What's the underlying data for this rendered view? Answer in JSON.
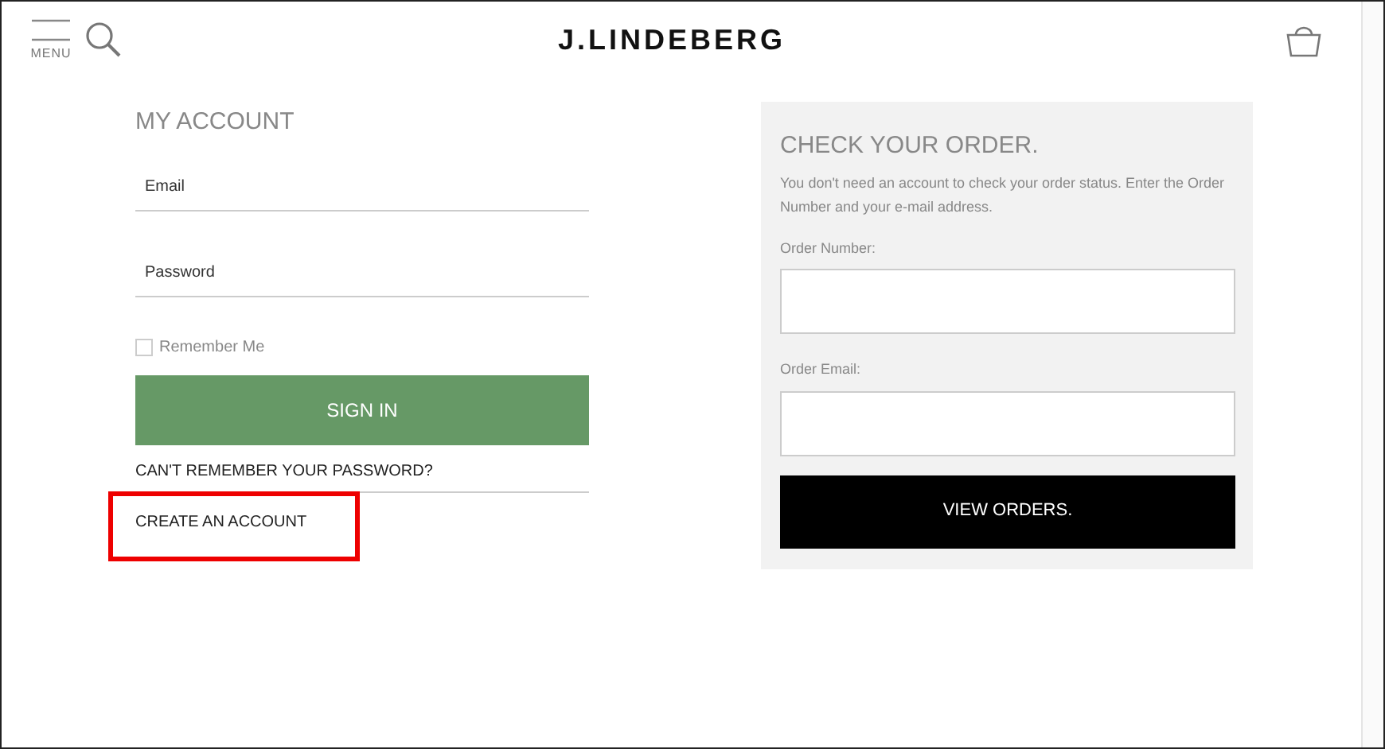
{
  "header": {
    "menu_label": "MENU",
    "brand": "J.LINDEBERG"
  },
  "account": {
    "title": "MY ACCOUNT",
    "fields": [
      {
        "placeholder": "Email"
      },
      {
        "placeholder": "Password"
      }
    ],
    "remember": {
      "label": "Remember Me",
      "checked": false
    },
    "sign_in": "SIGN IN",
    "links": [
      {
        "label": "CAN'T REMEMBER YOUR PASSWORD?",
        "highlighted": false
      },
      {
        "label": "CREATE AN ACCOUNT",
        "highlighted": true
      }
    ]
  },
  "order": {
    "title": "CHECK YOUR ORDER.",
    "description": "You don't need an account to check your order status. Enter the Order Number and your e-mail address.",
    "fields": [
      {
        "label": "Order Number:"
      },
      {
        "label": "Order Email:"
      }
    ],
    "button": "VIEW ORDERS."
  }
}
